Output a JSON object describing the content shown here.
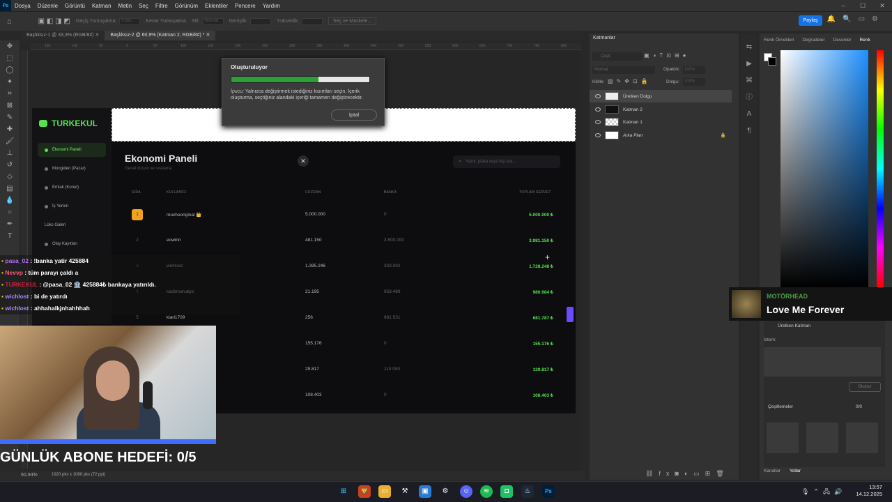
{
  "menu": [
    "Dosya",
    "Düzenle",
    "Görüntü",
    "Katman",
    "Metin",
    "Seç",
    "Filtre",
    "Görünüm",
    "Eklentiler",
    "Pencere",
    "Yardım"
  ],
  "options": {
    "feather": "Geçiş Yumuşatma:",
    "feather_val": "0 pks",
    "anti": "Kenar Yumuşatma",
    "style": "Stil:",
    "style_val": "Normal",
    "width": "Genişlik:",
    "height": "Yükseklik:",
    "select_mask": "Seç ve Maskele..."
  },
  "share": "Paylaş",
  "tabs": [
    "Başlıksız-1 @ 33,3% (RGB/8#)",
    "Başlıksız-2 @ 60,9% (Katman 2, RGB/8#) *"
  ],
  "ruler": [
    "150",
    "100",
    "50",
    "0",
    "50",
    "100",
    "150",
    "200",
    "250",
    "300",
    "350",
    "400",
    "450",
    "500",
    "550",
    "600",
    "650",
    "700",
    "750",
    "800"
  ],
  "app": {
    "brand": "TURKEKUL",
    "nav": [
      "Ekonomi Paneli",
      "Mongiden (Pazar)",
      "Emlak (Konut)",
      "İş Yerleri",
      "Lüks Galeri",
      "Olay Kayıtları"
    ],
    "title": "Ekonomi Paneli",
    "subtitle": "Genel durum ve sıralama",
    "search": "Yazık, plaka veya kişi ara...",
    "headers": [
      "SIRA",
      "KULLANICI",
      "CÜZDAN",
      "BANKA",
      "TOPLAM SERVET"
    ],
    "rows": [
      [
        "1",
        "muchooriginal 👑",
        "5.000.000",
        "0",
        "5.000.000 ₺"
      ],
      [
        "2",
        "eowinn",
        "481.150",
        "3.500.000",
        "3.981.150 ₺"
      ],
      [
        "3",
        "wichlost",
        "1.395.246",
        "333.002",
        "1.728.248 ₺"
      ],
      [
        "4",
        "kadimsevalye",
        "21.195",
        "959.489",
        "980.684 ₺"
      ],
      [
        "5",
        "kiari1709",
        "256",
        "681.531",
        "681.787 ₺"
      ],
      [
        "",
        "",
        "155.176",
        "0",
        "155.176 ₺"
      ],
      [
        "",
        "",
        "29.817",
        "110.000",
        "139.817 ₺"
      ],
      [
        "",
        "",
        "108.403",
        "0",
        "108.403 ₺"
      ]
    ]
  },
  "modal": {
    "title": "Oluşturuluyor",
    "progress": 0.63,
    "tip_label": "İpucu:",
    "tip": "Yalnızca değiştirmek istediğiniz kısımları seçin. İçerik oluşturma, seçtiğiniz alandaki içeriği tamamen değiştirecektir.",
    "cancel": "İptal"
  },
  "chat": [
    {
      "user": "pasa_02",
      "text": " : !banka yatir 425884",
      "color": "#b86bff"
    },
    {
      "user": "Nevvp",
      "text": " : tüm parayı çaldı a",
      "color": "#ff5a7a"
    },
    {
      "user": "TURKEKUL",
      "text": " : @pasa_02 🏦 425884₺ bankaya yatırıldı.",
      "color": "#d0203a"
    },
    {
      "user": "wichlost",
      "text": " : bi de yatırdı",
      "color": "#a98bff"
    },
    {
      "user": "wichlost",
      "text": " : ahhahalkjnhahhhah",
      "color": "#a98bff"
    }
  ],
  "goal": "GÜNLÜK ABONE HEDEFİ: 0/5",
  "status": {
    "zoom": "60,94%",
    "size": "1920 pks x 1080 pks (72 ppi)"
  },
  "layers": {
    "title": "Katmanlar",
    "kind": "Çeşit",
    "blend": "Normal",
    "opacity_label": "Opaklık:",
    "opacity": "100%",
    "lock_label": "Kilitle:",
    "fill_label": "Dolgu:",
    "fill": "100%",
    "items": [
      "Üretken Dolgu",
      "Katman 2",
      "Katman 1",
      "Arka Plan"
    ]
  },
  "right_tabs": [
    "Renk Örnekleri",
    "Degradeler",
    "Desenler",
    "Renk"
  ],
  "nowplaying": {
    "band": "MOTÖRHEAD",
    "song": "Love Me Forever"
  },
  "gen": {
    "title": "Üretken Katman",
    "prompt_label": "İstem:",
    "generate": "Oluştur",
    "variations": "Çeşitlemeler",
    "count": "0/0"
  },
  "bottom_tabs": [
    "Kanallar",
    "Yollar"
  ],
  "clock": {
    "time": "13:57",
    "date": "14.12.2025"
  }
}
